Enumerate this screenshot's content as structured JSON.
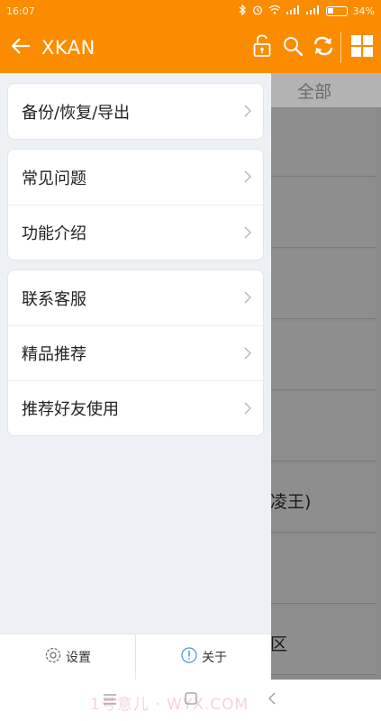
{
  "status_bar": {
    "time": "16:07",
    "battery": "34%",
    "battery_level": 0.34
  },
  "toolbar": {
    "title": "XKAN",
    "icons": [
      "back-arrow-icon",
      "lock-icon",
      "search-icon",
      "refresh-icon",
      "grid-icon"
    ]
  },
  "background": {
    "tab_label": "全部",
    "card_texts": [
      "",
      "",
      "",
      "",
      "",
      "凌王)",
      "",
      "区"
    ]
  },
  "drawer": {
    "groups": [
      {
        "items": [
          {
            "label": "备份/恢复/导出"
          }
        ]
      },
      {
        "items": [
          {
            "label": "常见问题"
          },
          {
            "label": "功能介绍"
          }
        ]
      },
      {
        "items": [
          {
            "label": "联系客服"
          },
          {
            "label": "精品推荐"
          },
          {
            "label": "推荐好友使用"
          }
        ]
      }
    ],
    "footer": {
      "settings_label": "设置",
      "about_label": "关于"
    }
  },
  "navbar": {
    "watermark": "1号意儿 · WYX.COM"
  },
  "colors": {
    "accent": "#fb8c00",
    "drawer_bg": "#edf1f5",
    "scrim": "#8a8a8a"
  }
}
